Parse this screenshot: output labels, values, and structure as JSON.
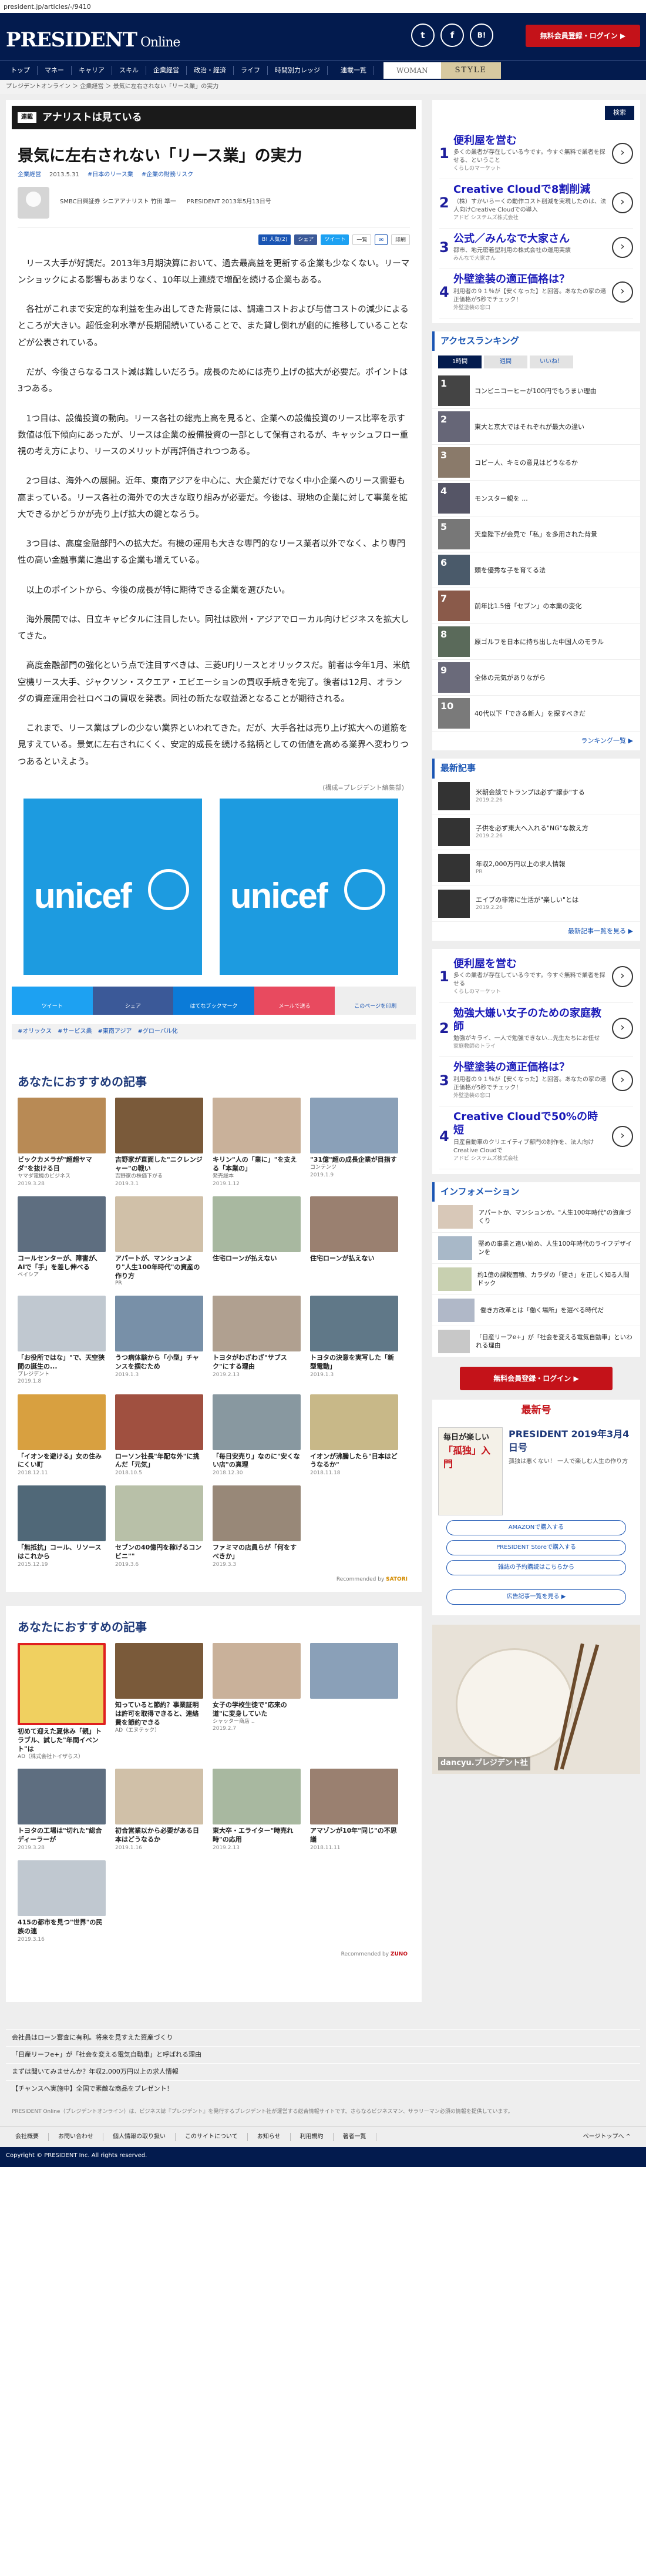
{
  "url": "president.jp/articles/-/9410",
  "header": {
    "logo": "PRESIDENT",
    "logo_sub": " Online",
    "social": [
      "t",
      "f",
      "B!"
    ],
    "member_btn": "無料会員登録・ログイン ▶"
  },
  "nav": {
    "items": [
      "トップ",
      "マネー",
      "キャリア",
      "スキル",
      "企業経営",
      "政治・経済",
      "ライフ",
      "時間別力レッジ",
      "連載一覧"
    ],
    "woman": "WOMAN",
    "style": "STYLE"
  },
  "breadcrumb": "プレジデントオンライン ＞ 企業経営 ＞ 景気に左右されない「リース業」の実力",
  "article": {
    "series_tag": "連載",
    "series": "アナリストは見ている",
    "title": "景気に左右されない「リース業」の実力",
    "meta": [
      "企業経営",
      "2013.5.31",
      "#日本のリース業",
      "#企業の財務リスク"
    ],
    "author": "SMBC日興証券 シニアアナリスト 竹田 準一",
    "source": "PRESIDENT 2013年5月13日号",
    "share": [
      "B! 人気(2)",
      "シェア",
      "ツイート",
      "一覧",
      "印刷"
    ],
    "paragraphs": [
      "リース大手が好調だ。2013年3月期決算において、過去最高益を更新する企業も少なくない。リーマンショックによる影響もあまりなく、10年以上連続で増配を続ける企業もある。",
      "各社がこれまで安定的な利益を生み出してきた背景には、調達コストおよび与信コストの減少によるところが大きい。超低金利水準が長期間続いていることで、また貸し倒れが劇的に推移していることなどが公表されている。",
      "だが、今後さらなるコスト減は難しいだろう。成長のためには売り上げの拡大が必要だ。ポイントは3つある。",
      "1つ目は、設備投資の動向。リース各社の総売上高を見ると、企業への設備投資のリース比率を示す数値は低下傾向にあったが、リースは企業の設備投資の一部として保有されるが、キャッシュフロー重視の考え方により、リースのメリットが再評価されつつある。",
      "2つ目は、海外への展開。近年、東南アジアを中心に、大企業だけでなく中小企業へのリース需要も高まっている。リース各社の海外での大きな取り組みが必要だ。今後は、現地の企業に対して事業を拡大できるかどうかが売り上げ拡大の鍵となろう。",
      "3つ目は、高度金融部門への拡大だ。有機の運用も大きな専門的なリース業者以外でなく、より専門性の高い金融事業に進出する企業も増えている。",
      "以上のポイントから、今後の成長が特に期待できる企業を選びたい。",
      "海外展開では、日立キャピタルに注目したい。同社は欧州・アジアでローカル向けビジネスを拡大してきた。",
      "高度金融部門の強化という点で注目すべきは、三菱UFJリースとオリックスだ。前者は今年1月、米航空機リース大手、ジャクソン・スクエア・エビエーションの買収手続きを完了。後者は12月、オランダの資産運用会社ロベコの買収を発表。同社の新たな収益源となることが期待される。",
      "これまで、リース業はプレの少ない業界といわれてきた。だが、大手各社は売り上げ拡大への道筋を見すえている。景気に左右されにくく、安定的成長を続ける銘柄としての価値を高める業界へ変わりつつあるといえよう。"
    ],
    "caption": "(構成=プレジデント編集部)",
    "image_text": [
      "unicef",
      "unicef"
    ],
    "share_buttons": [
      "ツイート",
      "シェア",
      "はてなブックマーク",
      "メールで送る",
      "このページを印刷"
    ],
    "tags": [
      "#オリックス",
      "#サービス業",
      "#東南アジア",
      "#グローバル化"
    ]
  },
  "rec1": {
    "heading": "あなたにおすすめの記事",
    "powered": "Recommended by",
    "cards": [
      {
        "t": "ビックカメラが\"超超ヤマダ\"を抜ける日",
        "s": "ヤマダ電機のビジネス",
        "d": "2019.3.28"
      },
      {
        "t": "吉野家が直面した\"ニクレンジャー\"の戦い",
        "s": "吉野家の株価下がる",
        "d": "2019.3.1"
      },
      {
        "t": "キリン\"人の「業に」\"を支える「本業の」",
        "s": "発売総本",
        "d": "2019.1.12"
      },
      {
        "t": "\"31億\"超の成長企業が目指す",
        "s": "コンテンツ",
        "d": "2019.1.9"
      },
      {
        "t": "コールセンターが、障害が、AIで「手」を差し伸べる",
        "s": "ベイシア",
        "d": ""
      },
      {
        "t": "アパートが、マンションより\"人生100年時代\"の資産の作り方",
        "s": "PR",
        "d": ""
      },
      {
        "t": "住宅ローンが払えない",
        "s": "",
        "d": ""
      },
      {
        "t": "住宅ローンが払えない",
        "s": "",
        "d": ""
      },
      {
        "t": "「お役所ではな」\"で、天空狭間の誕生の...",
        "s": "プレジデント",
        "d": "2019.1.8"
      },
      {
        "t": "うつ病体験から「小型」チャンスを掴むため",
        "s": "",
        "d": "2019.1.3"
      },
      {
        "t": "トヨタがわざわざ\"サブスク\"にする理由",
        "s": "",
        "d": "2019.2.13"
      },
      {
        "t": "トヨタの決意を実写した「新型電動」",
        "s": "",
        "d": "2019.1.3"
      },
      {
        "t": "「イオンを避ける」女の住みにくい町",
        "s": "",
        "d": "2018.12.11"
      },
      {
        "t": "ローソン社長\"年配な外\"に挑んだ「元気」",
        "s": "",
        "d": "2018.10.5"
      },
      {
        "t": "「毎日安売り」なのに\"安くない店\"の真理",
        "s": "",
        "d": "2018.12.30"
      },
      {
        "t": "イオンが沸騰したら\"日本はどうなるか\"",
        "s": "",
        "d": "2018.11.18"
      },
      {
        "t": "「無抵抗」コール、リソースはこれから",
        "s": "",
        "d": "2015.12.19"
      },
      {
        "t": "セブンの40億円を稼げるコンビニ\"\"",
        "s": "",
        "d": "2019.3.6"
      },
      {
        "t": "ファミマの店員らが「何をすべきか」",
        "s": "",
        "d": "2019.3.3"
      }
    ]
  },
  "rec2": {
    "heading": "あなたにおすすめの記事",
    "powered": "Recommended by",
    "cards": [
      {
        "t": "初めて迎えた夏休み「親」トラブル、試した\"年間イベント\"は",
        "s": "AD（株式会社トイザらス）",
        "d": ""
      },
      {
        "t": "知っていると節約？事業証明は許可を取得できると、連絡費を節約できる",
        "s": "AD（エヌテック）",
        "d": ""
      },
      {
        "t": "女子の学校生徒で\"応来の道\"に変身していた",
        "s": "シャッター商店 ..",
        "d": "2019.2.7"
      },
      {
        "t": "",
        "s": "",
        "d": ""
      },
      {
        "t": "トヨタの工場は\"切れた\"総合ディーラーが",
        "s": "",
        "d": "2019.3.28"
      },
      {
        "t": "初合営業以から必要がある日本はどうなるか",
        "s": "",
        "d": "2019.1.16"
      },
      {
        "t": "東大卒・エライター\"時売れ時\"の応用",
        "s": "",
        "d": "2019.2.13"
      },
      {
        "t": "アマゾンが10年\"同じ\"の不思議",
        "s": "",
        "d": "2018.11.11"
      },
      {
        "t": "415の都市を見つ\"世界\"の民族の連",
        "s": "",
        "d": "2019.3.16"
      }
    ]
  },
  "sidebar": {
    "search": "検索",
    "ad1": [
      {
        "n": "1",
        "h": "便利屋を営む",
        "d": "多くの業者が存在している今です。今すぐ無料で業者を探せる、ということ",
        "s": "くらしのマーケット"
      },
      {
        "n": "2",
        "h": "Creative Cloudで8割削減",
        "d": "（株）すかいらーくの動作コスト削減を実現したのは、法人向けCreative Cloudでの導入",
        "s": "アドビ システムズ株式会社"
      },
      {
        "n": "3",
        "h": "公式／みんなで大家さん",
        "d": "都市、地元密着型利用の株式会社の運用実績",
        "s": "みんなで大家さん"
      },
      {
        "n": "4",
        "h": "外壁塗装の適正価格は？",
        "d": "利用者の９１％が【安くなった】と回答。あなたの家の適正価格が5秒でチェック！",
        "s": "外壁塗装の窓口"
      }
    ],
    "ranking_hd": "アクセスランキング",
    "ranking_tabs": [
      "1時間",
      "週間",
      "いいね！"
    ],
    "ranking": [
      "コンビニコーヒーが100円でもうまい理由",
      "東大と京大ではそれぞれが最大の違い",
      "コピー人、キミの意見はどうなるか",
      "モンスター親を ... ",
      "天皇陛下が会見で「私」を多用された背景",
      "頭を優秀な子を育てる法",
      "前年比1.5倍「セブン」の本業の変化",
      "原ゴルフを日本に持ち出した中国人のモラル",
      "全体の元気がありながら",
      "40代以下「できる新人」を探すべきだ"
    ],
    "ranking_more": "ランキング一覧 ▶",
    "news_hd": "最新記事",
    "news": [
      {
        "t": "米朝会談でトランプは必ず\"譲歩\"する",
        "d": "2019.2.26"
      },
      {
        "t": "子供を必ず東大へ入れる\"NG\"な教え方",
        "d": "2019.2.26"
      },
      {
        "t": "年収2,000万円以上の求人情報",
        "d": "PR"
      },
      {
        "t": "エイブの非常に生活が\"楽しい\"とは",
        "d": "2019.2.26"
      }
    ],
    "news_more": "最新記事一覧を見る ▶",
    "ad2": [
      {
        "n": "1",
        "h": "便利屋を営む",
        "d": "多くの業者が存在している今です。今すぐ無料で業者を探せる",
        "s": "くらしのマーケット"
      },
      {
        "n": "2",
        "h": "勉強大嫌い女子のための家庭教師",
        "d": "勉強がキライ、一人で勉強できない...先生たちにお任せ",
        "s": "家庭教師のトライ"
      },
      {
        "n": "3",
        "h": "外壁塗装の適正価格は？",
        "d": "利用者の９１％が【安くなった】と回答。あなたの家の適正価格が5秒でチェック！",
        "s": "外壁塗装の窓口"
      },
      {
        "n": "4",
        "h": "Creative Cloudで50%の時短",
        "d": "日産自動車のクリエイティブ部門の制作を、法人向けCreative Cloudで",
        "s": "アドビ システムズ株式会社"
      }
    ],
    "info_hd": "インフォメーション",
    "info": [
      "アパートか、マンションか。\"人生100年時代\"の資産づくり",
      "堅めの事業と遠い始め、人生100年時代のライフデザインを",
      "約1億の課税面積、カラダの「健さ」を正しく知る人間ドック",
      "働き方改革とは「働く場所」を選べる時代だ",
      "「日産リーフe+」が「社会を変える電気自動車」といわれる理由"
    ],
    "member_btn": "無料会員登録・ログイン ▶",
    "issue_hd": "最新号",
    "issue": {
      "title": "PRESIDENT 2019年3月4日号",
      "cover1": "毎日が楽しい",
      "cover2": "「孤独」入門",
      "desc": "孤独は悪くない！ 一人で楽しむ人生の作り方",
      "btns": [
        "AMAZONで購入する",
        "PRESIDENT Storeで購入する",
        "雑誌の予約購読はこちらから"
      ],
      "more": "広告記事一覧を見る ▶"
    },
    "food_txt": "dancyu.プレジデント社"
  },
  "footer": {
    "links": [
      "会社員はローン審査に有利。将来を見すえた資産づくり",
      "「日産リーフe+」が「社会を変える電気自動車」と呼ばれる理由",
      "まずは聞いてみませんか？年収2,000万円以上の求人情報",
      "【チャンスへ実施中】全国で素敵な商品をプレゼント！"
    ],
    "desc": "PRESIDENT Online（プレジデントオンライン）は、ビジネス誌『プレジデント』を発行するプレジデント社が運営する総合情報サイトです。さらなるビジネスマン、サラリーマン必須の情報を提供しています。",
    "nav": [
      "会社概要",
      "お問い合わせ",
      "個人情報の取り扱い",
      "このサイトについて",
      "お知らせ",
      "利用規約",
      "著者一覧",
      "ページトップへ ^"
    ],
    "copy": "Copyright © PRESIDENT Inc. All rights reserved."
  },
  "colors": {
    "navy": "#031b4e",
    "red": "#c41219",
    "link": "#1a55b3",
    "unicef": "#1d9be0"
  }
}
